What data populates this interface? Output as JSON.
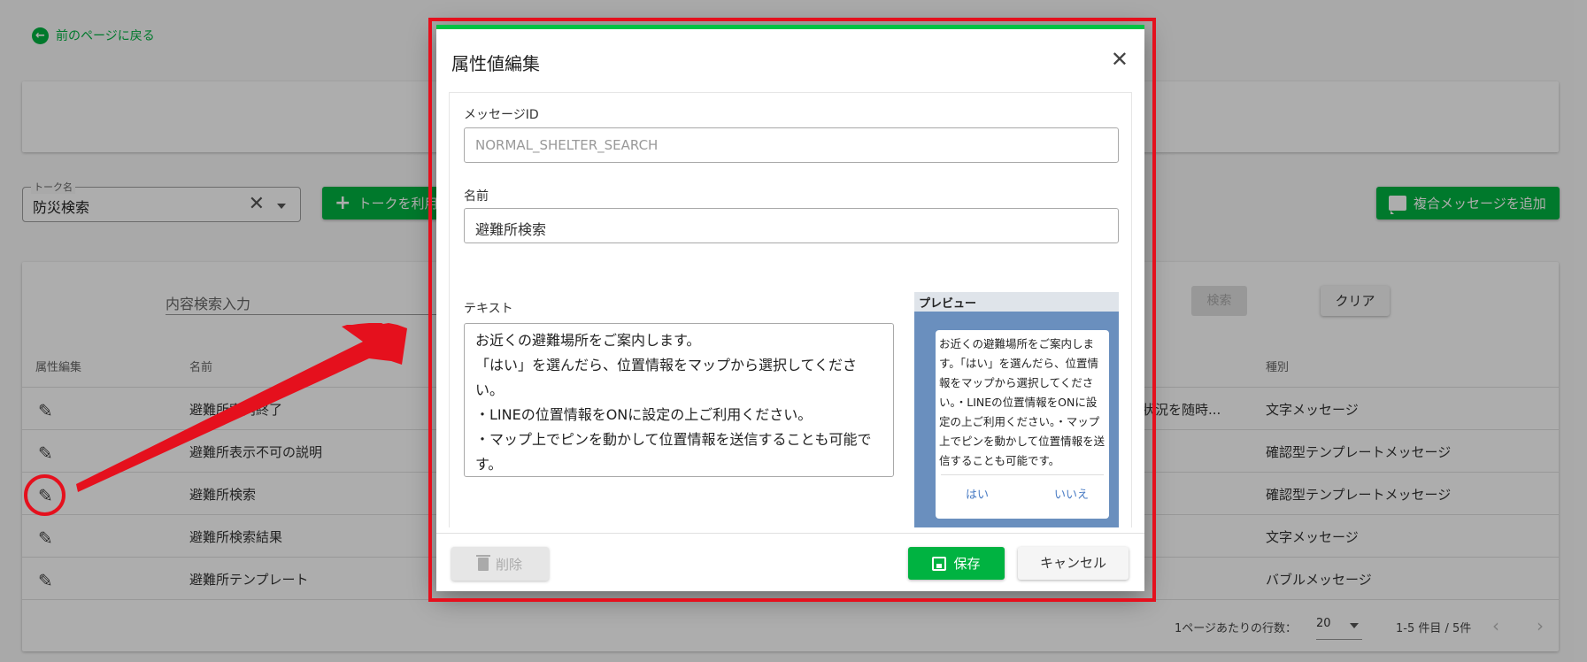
{
  "page": {
    "back_link": "前のページに戻る",
    "talk_select": {
      "label": "トーク名",
      "value": "防災検索"
    },
    "use_talk_button": "トークを利用",
    "add_multi_message_button": "複合メッセージを追加",
    "search_placeholder": "内容検索入力",
    "search_button": "検索",
    "clear_button": "クリア",
    "table": {
      "headers": {
        "edit": "属性編集",
        "name": "名前",
        "kind": "種別"
      },
      "rows": [
        {
          "name": "避難所案内終了",
          "extra": "状況を随時...",
          "kind": "文字メッセージ"
        },
        {
          "name": "避難所表示不可の説明",
          "extra": "",
          "kind": "確認型テンプレートメッセージ"
        },
        {
          "name": "避難所検索",
          "extra": "",
          "kind": "確認型テンプレートメッセージ"
        },
        {
          "name": "避難所検索結果",
          "extra": "",
          "kind": "文字メッセージ"
        },
        {
          "name": "避難所テンプレート",
          "extra": "",
          "kind": "バブルメッセージ"
        }
      ]
    },
    "pager": {
      "rows_per_page_label": "1ページあたりの行数：",
      "rows_per_page": "20",
      "range": "1-5 件目 / 5件"
    }
  },
  "dialog": {
    "title": "属性値編集",
    "message_id_label": "メッセージID",
    "message_id_value": "NORMAL_SHELTER_SEARCH",
    "name_label": "名前",
    "name_value": "避難所検索",
    "text_label": "テキスト",
    "text_value": "お近くの避難場所をご案内します。\n「はい」を選んだら、位置情報をマップから選択してください。\n・LINEの位置情報をONに設定の上ご利用ください。\n・マップ上でピンを動かして位置情報を送信することも可能です。",
    "preview": {
      "label": "プレビュー",
      "text": "お近くの避難場所をご案内します。「はい」を選んだら、位置情報をマップから選択してください。・LINEの位置情報をONに設定の上ご利用ください。・マップ上でピンを動かして位置情報を送信することも可能です。",
      "yes": "はい",
      "no": "いいえ"
    },
    "delete_button": "削除",
    "save_button": "保存",
    "cancel_button": "キャンセル"
  },
  "colors": {
    "accent": "#00b341",
    "annotation": "#e5101d",
    "preview_bg": "#6a8fbe"
  }
}
